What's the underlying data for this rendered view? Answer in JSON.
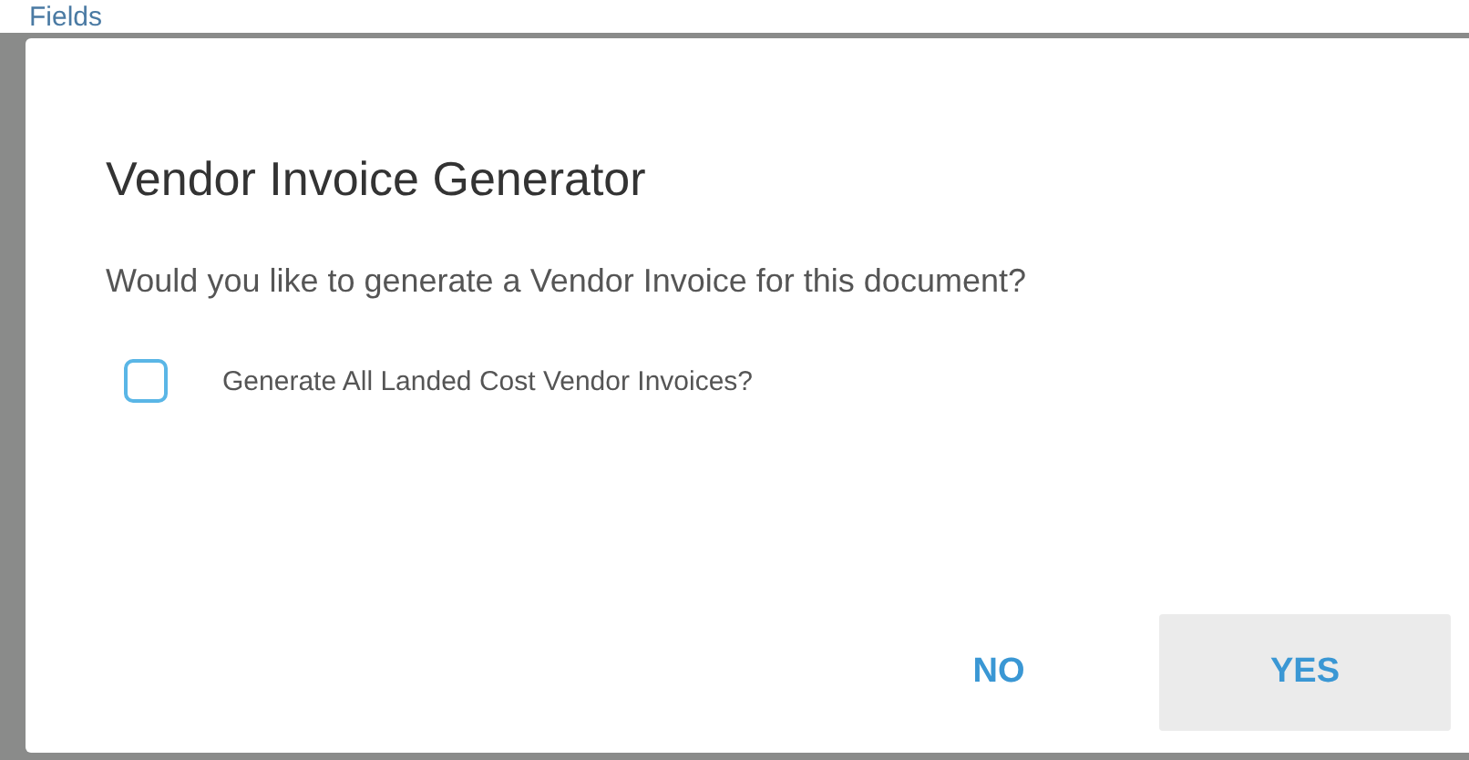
{
  "background": {
    "heading": "Fields"
  },
  "dialog": {
    "title": "Vendor Invoice Generator",
    "message": "Would you like to generate a Vendor Invoice for this document?",
    "checkbox": {
      "label": "Generate All Landed Cost Vendor Invoices?",
      "checked": false
    },
    "buttons": [
      {
        "label": "NO",
        "kind": "flat"
      },
      {
        "label": "YES",
        "kind": "raised"
      }
    ]
  }
}
